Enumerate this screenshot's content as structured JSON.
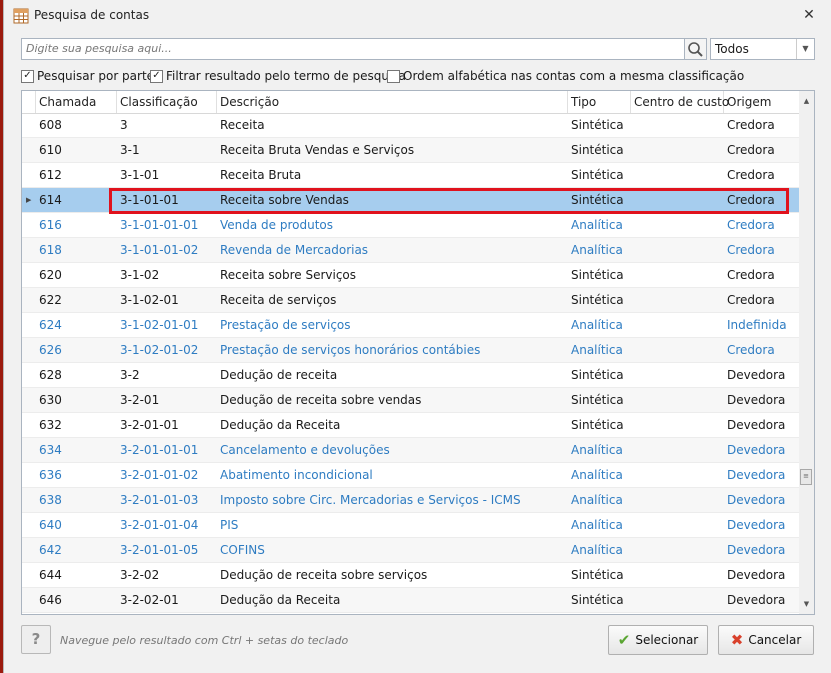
{
  "window": {
    "title": "Pesquisa de contas",
    "close_glyph": "✕"
  },
  "search": {
    "placeholder": "Digite sua pesquisa aqui...",
    "filter_value": "Todos"
  },
  "options": [
    {
      "label": "Pesquisar por parte",
      "checked": true
    },
    {
      "label": "Filtrar resultado pelo termo de pesquisa",
      "checked": true
    },
    {
      "label": "Ordem alfabética nas contas com a mesma classificação",
      "checked": false
    }
  ],
  "table": {
    "columns": [
      "Chamada",
      "Classificação",
      "Descrição",
      "Tipo",
      "Centro de custo",
      "Origem"
    ],
    "rows": [
      {
        "chamada": "608",
        "classificacao": "3",
        "descricao": "Receita",
        "tipo": "Sintética",
        "centro": "",
        "origem": "Credora",
        "style": "dark"
      },
      {
        "chamada": "610",
        "classificacao": "3-1",
        "descricao": "Receita Bruta Vendas e Serviços",
        "tipo": "Sintética",
        "centro": "",
        "origem": "Credora",
        "style": "dark"
      },
      {
        "chamada": "612",
        "classificacao": "3-1-01",
        "descricao": "Receita Bruta",
        "tipo": "Sintética",
        "centro": "",
        "origem": "Credora",
        "style": "dark"
      },
      {
        "chamada": "614",
        "classificacao": "3-1-01-01",
        "descricao": "Receita sobre Vendas",
        "tipo": "Sintética",
        "centro": "",
        "origem": "Credora",
        "style": "dark",
        "selected": true
      },
      {
        "chamada": "616",
        "classificacao": "3-1-01-01-01",
        "descricao": "Venda de produtos",
        "tipo": "Analítica",
        "centro": "",
        "origem": "Credora",
        "style": "blue"
      },
      {
        "chamada": "618",
        "classificacao": "3-1-01-01-02",
        "descricao": "Revenda de Mercadorias",
        "tipo": "Analítica",
        "centro": "",
        "origem": "Credora",
        "style": "blue"
      },
      {
        "chamada": "620",
        "classificacao": "3-1-02",
        "descricao": "Receita sobre Serviços",
        "tipo": "Sintética",
        "centro": "",
        "origem": "Credora",
        "style": "dark"
      },
      {
        "chamada": "622",
        "classificacao": "3-1-02-01",
        "descricao": "Receita de serviços",
        "tipo": "Sintética",
        "centro": "",
        "origem": "Credora",
        "style": "dark"
      },
      {
        "chamada": "624",
        "classificacao": "3-1-02-01-01",
        "descricao": "Prestação de serviços",
        "tipo": "Analítica",
        "centro": "",
        "origem": "Indefinida",
        "style": "blue"
      },
      {
        "chamada": "626",
        "classificacao": "3-1-02-01-02",
        "descricao": "Prestação de serviços honorários contábies",
        "tipo": "Analítica",
        "centro": "",
        "origem": "Credora",
        "style": "blue"
      },
      {
        "chamada": "628",
        "classificacao": "3-2",
        "descricao": "Dedução de receita",
        "tipo": "Sintética",
        "centro": "",
        "origem": "Devedora",
        "style": "dark"
      },
      {
        "chamada": "630",
        "classificacao": "3-2-01",
        "descricao": "Dedução de receita sobre vendas",
        "tipo": "Sintética",
        "centro": "",
        "origem": "Devedora",
        "style": "dark"
      },
      {
        "chamada": "632",
        "classificacao": "3-2-01-01",
        "descricao": "Dedução da Receita",
        "tipo": "Sintética",
        "centro": "",
        "origem": "Devedora",
        "style": "dark"
      },
      {
        "chamada": "634",
        "classificacao": "3-2-01-01-01",
        "descricao": "Cancelamento e devoluções",
        "tipo": "Analítica",
        "centro": "",
        "origem": "Devedora",
        "style": "blue"
      },
      {
        "chamada": "636",
        "classificacao": "3-2-01-01-02",
        "descricao": "Abatimento incondicional",
        "tipo": "Analítica",
        "centro": "",
        "origem": "Devedora",
        "style": "blue"
      },
      {
        "chamada": "638",
        "classificacao": "3-2-01-01-03",
        "descricao": "Imposto sobre Circ. Mercadorias e Serviços - ICMS",
        "tipo": "Analítica",
        "centro": "",
        "origem": "Devedora",
        "style": "blue"
      },
      {
        "chamada": "640",
        "classificacao": "3-2-01-01-04",
        "descricao": "PIS",
        "tipo": "Analítica",
        "centro": "",
        "origem": "Devedora",
        "style": "blue"
      },
      {
        "chamada": "642",
        "classificacao": "3-2-01-01-05",
        "descricao": "COFINS",
        "tipo": "Analítica",
        "centro": "",
        "origem": "Devedora",
        "style": "blue"
      },
      {
        "chamada": "644",
        "classificacao": "3-2-02",
        "descricao": "Dedução de receita sobre serviços",
        "tipo": "Sintética",
        "centro": "",
        "origem": "Devedora",
        "style": "dark"
      },
      {
        "chamada": "646",
        "classificacao": "3-2-02-01",
        "descricao": "Dedução da Receita",
        "tipo": "Sintética",
        "centro": "",
        "origem": "Devedora",
        "style": "dark"
      }
    ]
  },
  "footer": {
    "help_label": "?",
    "hint": "Navegue pelo resultado com Ctrl + setas do teclado",
    "select_label": "Selecionar",
    "cancel_label": "Cancelar"
  },
  "colors": {
    "blue_text": "#2e7cc2",
    "selected_row": "#a6cdee",
    "highlight_border": "#e0121d",
    "accept_green": "#5aa532",
    "cancel_red": "#d9412c"
  }
}
